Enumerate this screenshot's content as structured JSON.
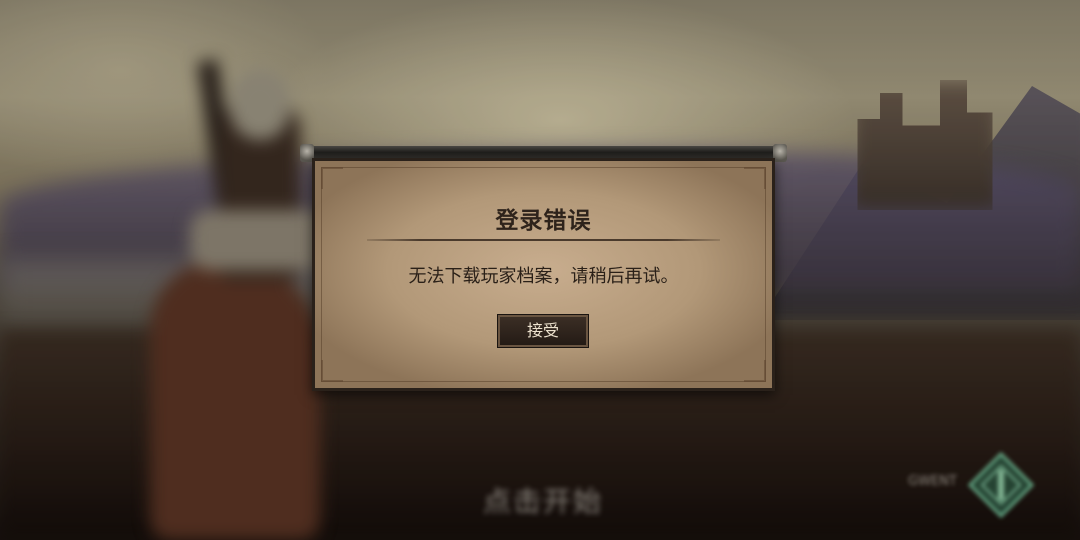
{
  "dialog": {
    "title": "登录错误",
    "message": "无法下载玩家档案，请稍后再试。",
    "accept_label": "接受"
  },
  "background": {
    "start_hint": "点击开始",
    "corner_label": "GWENT",
    "corner_icon": "emblem-icon"
  },
  "colors": {
    "parchment": "#c8ad8e",
    "button": "#2f241c",
    "text": "#2e231b"
  }
}
